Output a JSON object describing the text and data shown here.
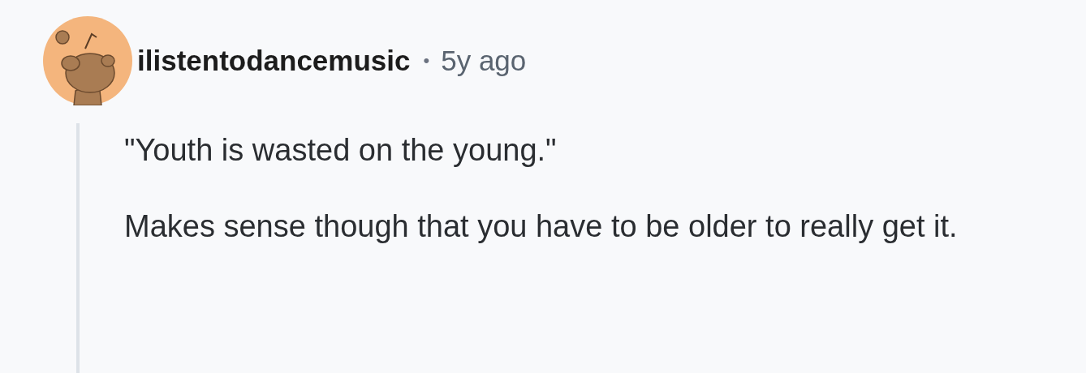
{
  "comment": {
    "author": "ilistentodancemusic",
    "separator": "•",
    "time": "5y ago",
    "paragraphs": [
      "\"Youth is wasted on the young.\"",
      "Makes sense though that you have to be older to really get it."
    ]
  }
}
